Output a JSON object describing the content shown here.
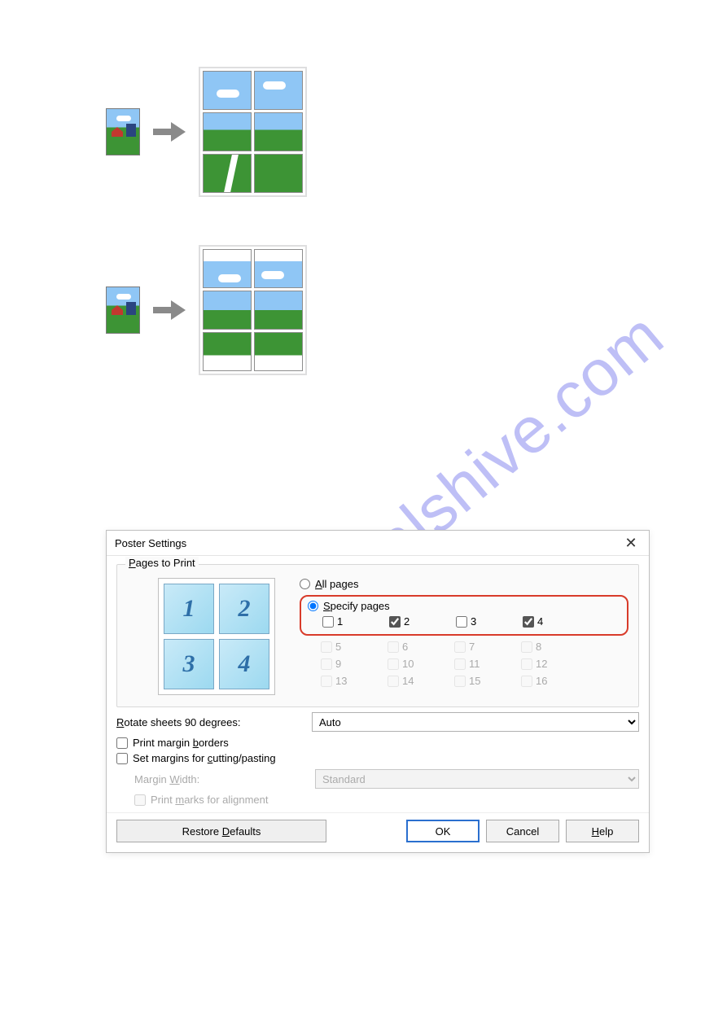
{
  "watermark": "manualshive.com",
  "dialog": {
    "title": "Poster Settings",
    "close_label": "✕",
    "pages_group_prefix": "P",
    "pages_group_suffix": "ages to Print",
    "radio_all_prefix": "A",
    "radio_all_suffix": "ll pages",
    "radio_specify_prefix": "S",
    "radio_specify_suffix": "pecify pages",
    "preview_numbers": [
      "1",
      "2",
      "3",
      "4"
    ],
    "page_checks_row1": [
      {
        "n": "1",
        "checked": false
      },
      {
        "n": "2",
        "checked": true
      },
      {
        "n": "3",
        "checked": false
      },
      {
        "n": "4",
        "checked": true
      }
    ],
    "page_checks_rest": [
      [
        "5",
        "6",
        "7",
        "8"
      ],
      [
        "9",
        "10",
        "11",
        "12"
      ],
      [
        "13",
        "14",
        "15",
        "16"
      ]
    ],
    "rotate_lbl_prefix": "R",
    "rotate_lbl_suffix": "otate sheets 90 degrees:",
    "rotate_value": "Auto",
    "margin_borders_prefix1": "Print margin ",
    "margin_borders_u": "b",
    "margin_borders_suffix": "orders",
    "cutpaste_prefix": "Set margins for ",
    "cutpaste_u": "c",
    "cutpaste_suffix": "utting/pasting",
    "margin_width_prefix": "Margin ",
    "margin_width_u": "W",
    "margin_width_suffix": "idth:",
    "margin_width_value": "Standard",
    "marks_prefix": "Print ",
    "marks_u": "m",
    "marks_suffix": "arks for alignment",
    "restore_prefix": "Restore ",
    "restore_u": "D",
    "restore_suffix": "efaults",
    "ok": "OK",
    "cancel": "Cancel",
    "help_u": "H",
    "help_suffix": "elp"
  }
}
